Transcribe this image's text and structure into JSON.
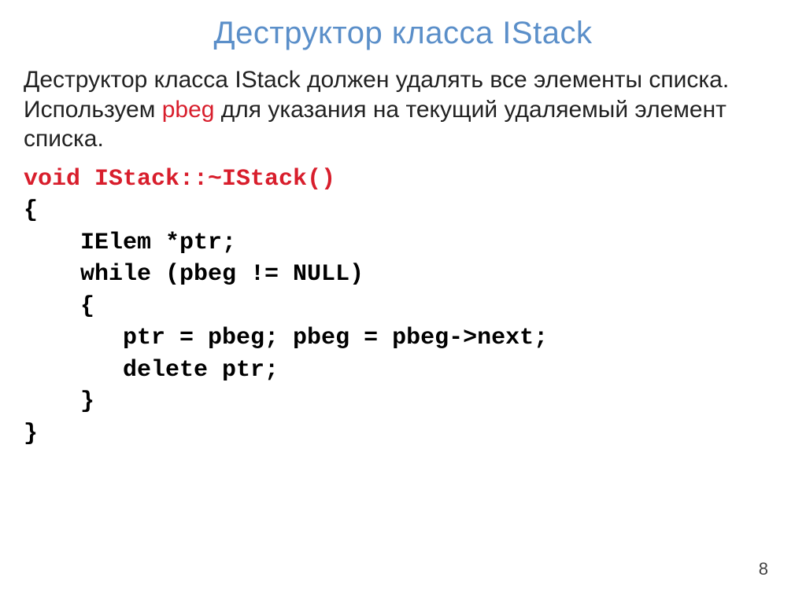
{
  "title": "Деструктор класса IStack",
  "body": {
    "t1": "Деструктор класса IStack должен удалять все элементы списка. Используем ",
    "pbeg": "pbeg",
    "t2": " для указания на текущий удаляемый элемент списка."
  },
  "code": {
    "l1a": "void",
    "l1b": " IStack::~IStack()",
    "l2": "{",
    "l3": "    IElem *ptr;",
    "l4": "    while (pbeg != NULL)",
    "l5": "    {",
    "l6": "       ptr = pbeg; pbeg = pbeg->next;",
    "l7": "       delete ptr;",
    "l8": "    }",
    "l9": "}"
  },
  "pageNumber": "8"
}
